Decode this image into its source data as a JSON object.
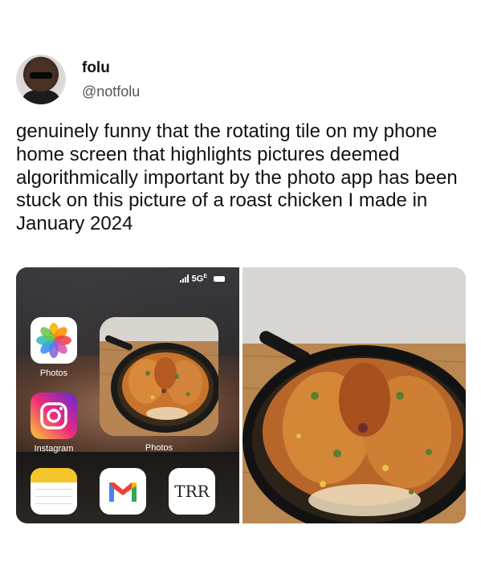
{
  "author": {
    "name": "folu",
    "handle": "@notfolu"
  },
  "tweet": {
    "text": "genuinely funny that the rotating tile on my phone home screen that highlights pictures deemed algorithmically important by the photo app has been stuck on this picture of a roast chicken I made in January 2024"
  },
  "screenshot": {
    "status_bar": {
      "network": "5G",
      "network_sup": "E"
    },
    "apps": [
      {
        "label": "Photos",
        "icon": "photos-icon"
      },
      {
        "label": "Instagram",
        "icon": "instagram-icon"
      },
      {
        "label": "Notes",
        "icon": "notes-icon"
      },
      {
        "label": "Gmail",
        "icon": "gmail-icon"
      },
      {
        "label": "TRR",
        "icon": "trr-icon"
      }
    ],
    "widget": {
      "label": "Photos"
    }
  }
}
